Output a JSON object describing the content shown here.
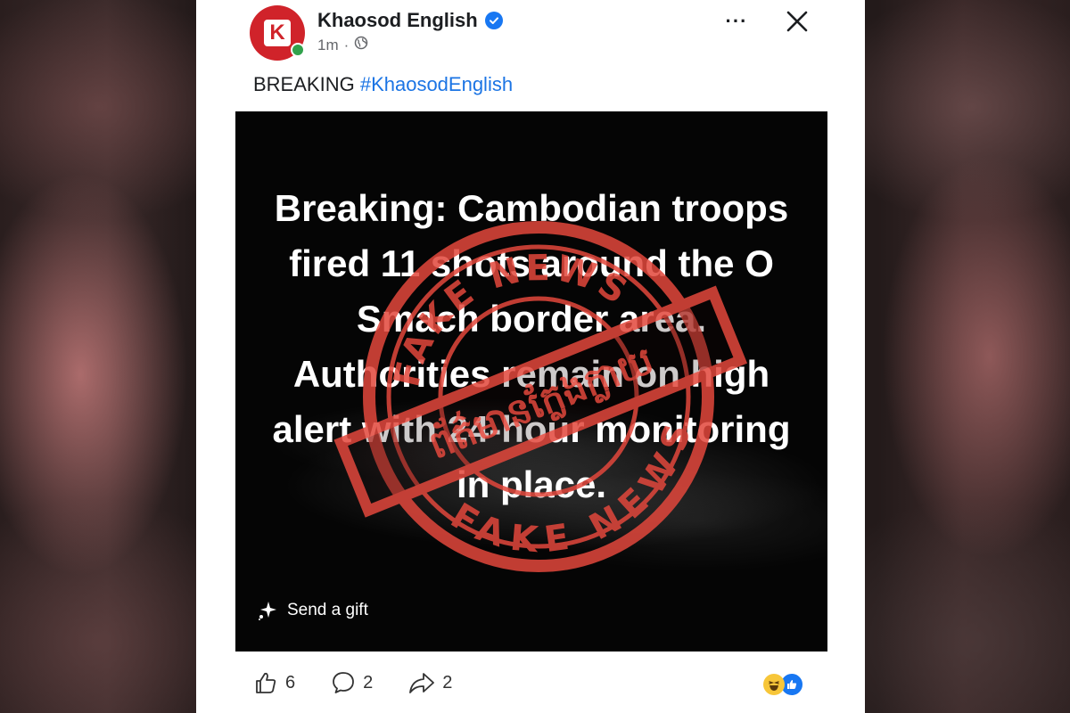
{
  "post": {
    "page_name": "Khaosod English",
    "avatar_letter": "K",
    "timestamp": "1m",
    "separator": "·",
    "privacy_icon": "globe-icon",
    "more_icon": "ellipsis-icon",
    "more_label": "···",
    "close_icon": "close-icon",
    "text_prefix": "BREAKING",
    "hashtag": "#KhaosodEnglish"
  },
  "media": {
    "headline": "Breaking: Cambodian troops fired 11 shots around the O Smach border area. Authorities remain on high alert with 24-hour monitoring in place.",
    "stamp_top_text": "FAKE NEWS",
    "stamp_bottom_text": "FAKE NEWS",
    "stamp_khmer_text": "ព័ត៌មានក្លែងក្លាយ",
    "stamp_color": "#e2473c",
    "gift_icon": "gift-sparkle-icon",
    "gift_label": "Send a gift"
  },
  "footer": {
    "like_icon": "thumbs-up-icon",
    "likes": "6",
    "comment_icon": "comment-icon",
    "comments": "2",
    "share_icon": "share-icon",
    "shares": "2",
    "reaction_icons": [
      "haha-reaction-icon",
      "like-reaction-icon"
    ]
  },
  "colors": {
    "link": "#1b74e4",
    "verified": "#1877f2",
    "brand": "#d0232a"
  }
}
